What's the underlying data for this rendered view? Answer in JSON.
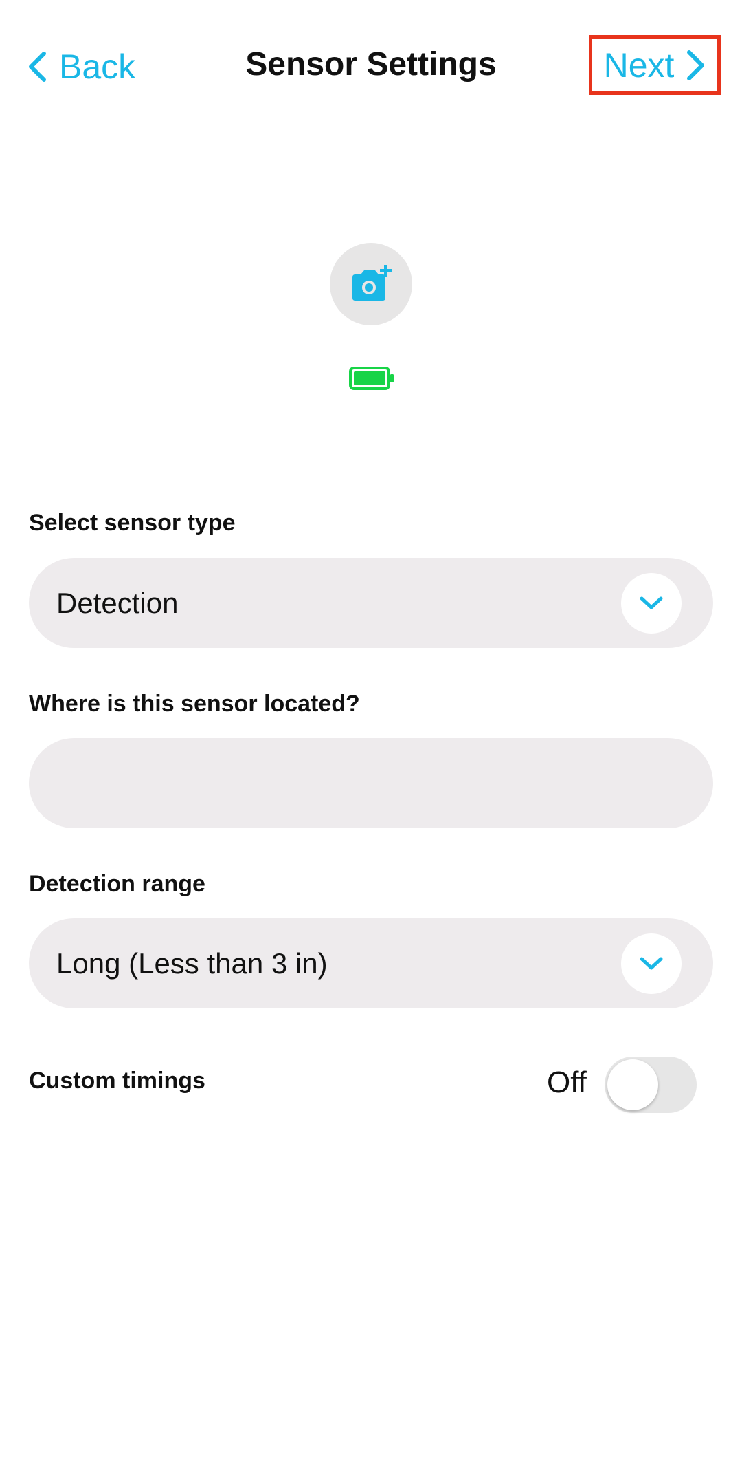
{
  "header": {
    "back_label": "Back",
    "title": "Sensor Settings",
    "next_label": "Next"
  },
  "fields": {
    "sensor_type": {
      "label": "Select sensor type",
      "value": "Detection"
    },
    "location": {
      "label": "Where is this sensor located?",
      "value": "",
      "placeholder": ""
    },
    "detection_range": {
      "label": "Detection range",
      "value": "Long (Less than 3 in)"
    },
    "custom_timings": {
      "label": "Custom timings",
      "state_label": "Off",
      "enabled": false
    }
  },
  "icons": {
    "back": "chevron-left-icon",
    "next": "chevron-right-icon",
    "camera": "camera-add-icon",
    "battery": "battery-full-icon",
    "dropdown": "chevron-down-icon"
  },
  "colors": {
    "accent": "#1ab7e6",
    "highlight_border": "#e8341c",
    "battery": "#18d447",
    "field_bg": "#eeebed"
  }
}
